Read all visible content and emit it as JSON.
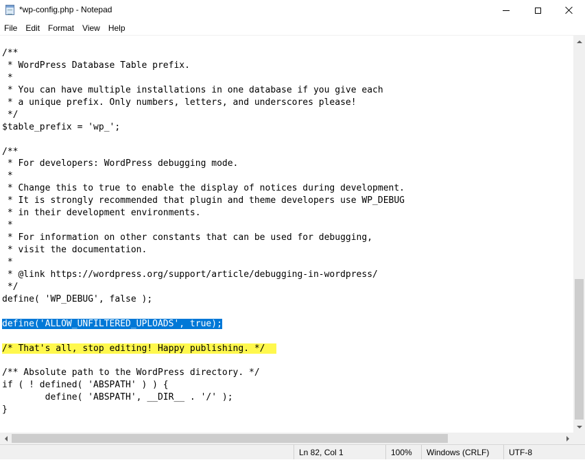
{
  "window": {
    "title": "*wp-config.php - Notepad",
    "app_icon": "notepad-icon"
  },
  "menu": [
    {
      "label": "File"
    },
    {
      "label": "Edit"
    },
    {
      "label": "Format"
    },
    {
      "label": "View"
    },
    {
      "label": "Help"
    }
  ],
  "editor": {
    "lines": [
      "/**",
      " * WordPress Database Table prefix.",
      " *",
      " * You can have multiple installations in one database if you give each",
      " * a unique prefix. Only numbers, letters, and underscores please!",
      " */",
      "$table_prefix = 'wp_';",
      "",
      "/**",
      " * For developers: WordPress debugging mode.",
      " *",
      " * Change this to true to enable the display of notices during development.",
      " * It is strongly recommended that plugin and theme developers use WP_DEBUG",
      " * in their development environments.",
      " *",
      " * For information on other constants that can be used for debugging,",
      " * visit the documentation.",
      " *",
      " * @link https://wordpress.org/support/article/debugging-in-wordpress/",
      " */",
      "define( 'WP_DEBUG', false );",
      "",
      "define('ALLOW_UNFILTERED_UPLOADS', true);",
      "",
      "/* That's all, stop editing! Happy publishing. */",
      "",
      "/** Absolute path to the WordPress directory. */",
      "if ( ! defined( 'ABSPATH' ) ) {",
      "        define( 'ABSPATH', __DIR__ . '/' );",
      "}",
      ""
    ],
    "selected_line": 22,
    "highlighted_line": 24,
    "selection_color": "#0078d7",
    "highlight_color": "#fff84d"
  },
  "status": {
    "position": "Ln 82, Col 1",
    "zoom": "100%",
    "line_ending": "Windows (CRLF)",
    "encoding": "UTF-8"
  }
}
